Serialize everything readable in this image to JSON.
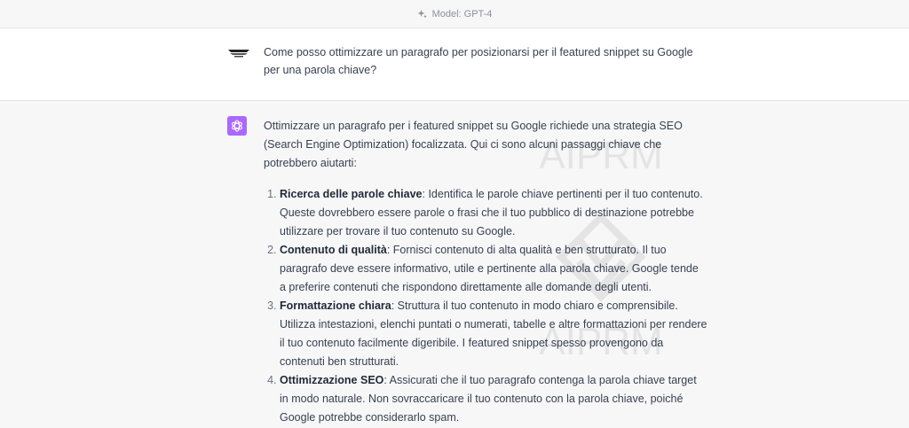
{
  "header": {
    "model_label": "Model: GPT-4"
  },
  "user_message": {
    "text": "Come posso ottimizzare un paragrafo per posizionarsi per il featured snippet su Google per una parola chiave?"
  },
  "assistant_message": {
    "intro": "Ottimizzare un paragrafo per i featured snippet su Google richiede una strategia SEO (Search Engine Optimization) focalizzata. Qui ci sono alcuni passaggi chiave che potrebbero aiutarti:",
    "items": [
      {
        "title": "Ricerca delle parole chiave",
        "text": ": Identifica le parole chiave pertinenti per il tuo contenuto. Queste dovrebbero essere parole o frasi che il tuo pubblico di destinazione potrebbe utilizzare per trovare il tuo contenuto su Google."
      },
      {
        "title": "Contenuto di qualità",
        "text": ": Fornisci contenuto di alta qualità e ben strutturato. Il tuo paragrafo deve essere informativo, utile e pertinente alla parola chiave. Google tende a preferire contenuti che rispondono direttamente alle domande degli utenti."
      },
      {
        "title": "Formattazione chiara",
        "text": ": Struttura il tuo contenuto in modo chiaro e comprensibile. Utilizza intestazioni, elenchi puntati o numerati, tabelle e altre formattazioni per rendere il tuo contenuto facilmente digeribile. I featured snippet spesso provengono da contenuti ben strutturati."
      },
      {
        "title": "Ottimizzazione SEO",
        "text": ": Assicurati che il tuo paragrafo contenga la parola chiave target in modo naturale. Non sovraccaricare il tuo contenuto con la parola chiave, poiché Google potrebbe considerarlo spam."
      }
    ]
  },
  "watermark": {
    "text": "AIPRM"
  },
  "icons": {
    "model": "sparkle-icon",
    "assistant": "openai-logo-icon",
    "user": "user-avatar-logo"
  },
  "colors": {
    "assistant_avatar_bg": "#ab68ff",
    "assistant_bg": "#f7f7f8",
    "text": "#374151"
  }
}
